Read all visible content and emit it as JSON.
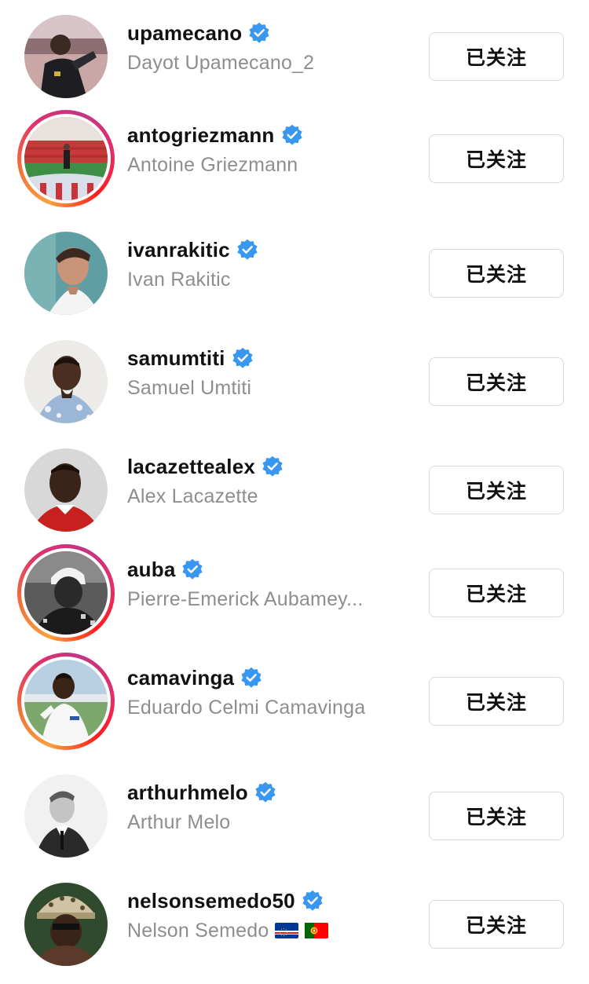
{
  "follow_label": "已关注",
  "colors": {
    "verified_blue": "#3897f0",
    "secondary_text": "#8e8e8e",
    "primary_text": "#111111",
    "button_border": "#d8d8d8"
  },
  "accounts": [
    {
      "username": "upamecano",
      "full_name": "Dayot Upamecano_2",
      "verified": true,
      "story_ring": false,
      "avatar_icon": "profile-photo"
    },
    {
      "username": "antogriezmann",
      "full_name": "Antoine Griezmann",
      "verified": true,
      "story_ring": true,
      "avatar_icon": "profile-photo"
    },
    {
      "username": "ivanrakitic",
      "full_name": "Ivan Rakitic",
      "verified": true,
      "story_ring": false,
      "avatar_icon": "profile-photo"
    },
    {
      "username": "samumtiti",
      "full_name": "Samuel Umtiti",
      "verified": true,
      "story_ring": false,
      "avatar_icon": "profile-photo"
    },
    {
      "username": "lacazettealex",
      "full_name": "Alex Lacazette",
      "verified": true,
      "story_ring": false,
      "avatar_icon": "profile-photo"
    },
    {
      "username": "auba",
      "full_name": "Pierre-Emerick Aubamey...",
      "verified": true,
      "story_ring": true,
      "avatar_icon": "profile-photo"
    },
    {
      "username": "camavinga",
      "full_name": "Eduardo Celmi Camavinga",
      "verified": true,
      "story_ring": true,
      "avatar_icon": "profile-photo"
    },
    {
      "username": "arthurhmelo",
      "full_name": "Arthur Melo",
      "verified": true,
      "story_ring": false,
      "avatar_icon": "profile-photo"
    },
    {
      "username": "nelsonsemedo50",
      "full_name": "Nelson Semedo",
      "verified": true,
      "story_ring": false,
      "avatar_icon": "profile-photo",
      "flags": [
        "cape-verde-flag-icon",
        "portugal-flag-icon"
      ]
    }
  ]
}
